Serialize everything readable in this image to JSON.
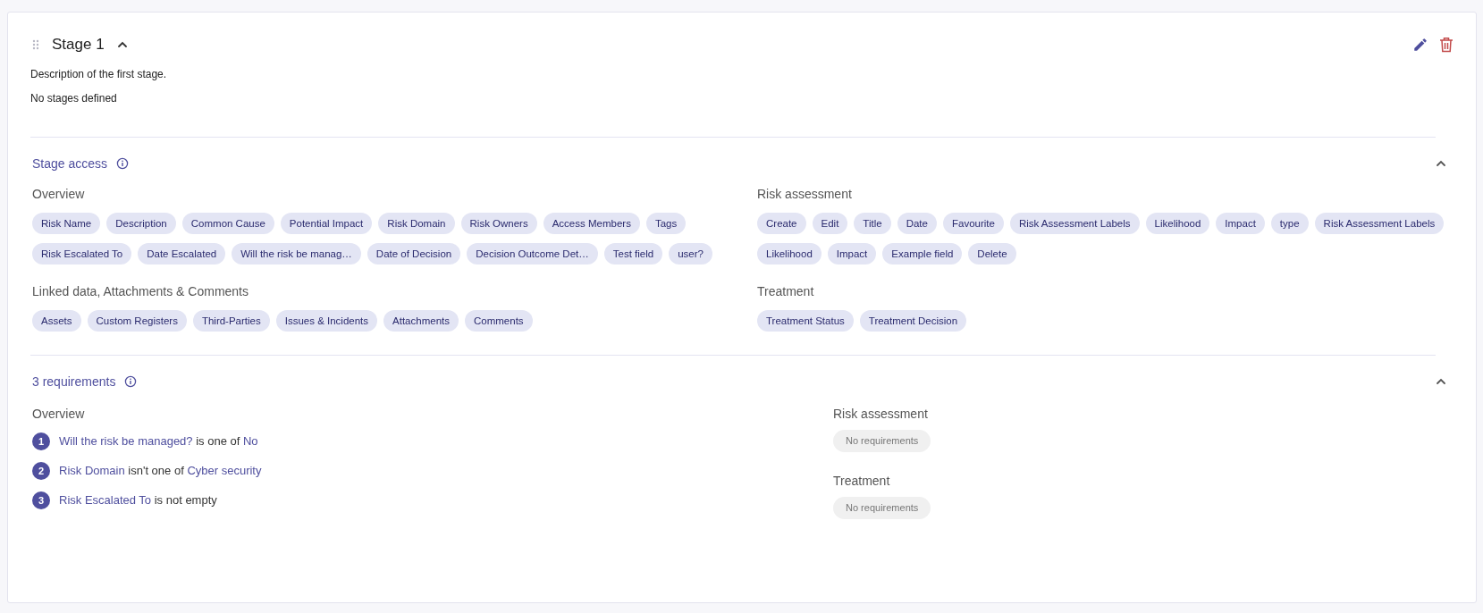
{
  "stage": {
    "title": "Stage 1",
    "expanded": true,
    "description": "Description of the first stage.",
    "note": "No stages defined"
  },
  "access": {
    "title": "Stage access",
    "expanded": true,
    "groups": [
      {
        "title": "Overview",
        "chips": [
          "Risk Name",
          "Description",
          "Common Cause",
          "Potential Impact",
          "Risk Domain",
          "Risk Owners",
          "Access Members",
          "Tags",
          "Risk Escalated To",
          "Date Escalated",
          "Will the risk be manag…",
          "Date of Decision",
          "Decision Outcome Det…",
          "Test field",
          "user?"
        ]
      },
      {
        "title": "Risk assessment",
        "chips": [
          "Create",
          "Edit",
          "Title",
          "Date",
          "Favourite",
          "Risk Assessment Labels",
          "Likelihood",
          "Impact",
          "type",
          "Risk Assessment Labels",
          "Likelihood",
          "Impact",
          "Example field",
          "Delete"
        ]
      },
      {
        "title": "Linked data, Attachments & Comments",
        "chips": [
          "Assets",
          "Custom Registers",
          "Third-Parties",
          "Issues & Incidents",
          "Attachments",
          "Comments"
        ]
      },
      {
        "title": "Treatment",
        "chips": [
          "Treatment Status",
          "Treatment Decision"
        ]
      }
    ]
  },
  "requirements": {
    "title": "3 requirements",
    "expanded": true,
    "overview": {
      "title": "Overview",
      "items": [
        {
          "number": "1",
          "field": "Will the risk be managed?",
          "operator": "is one of",
          "value": "No"
        },
        {
          "number": "2",
          "field": "Risk Domain",
          "operator": "isn't one of",
          "value": "Cyber security"
        },
        {
          "number": "3",
          "field": "Risk Escalated To",
          "operator": "is not empty"
        }
      ]
    },
    "side": [
      {
        "title": "Risk assessment",
        "empty": "No requirements"
      },
      {
        "title": "Treatment",
        "empty": "No requirements"
      }
    ]
  }
}
